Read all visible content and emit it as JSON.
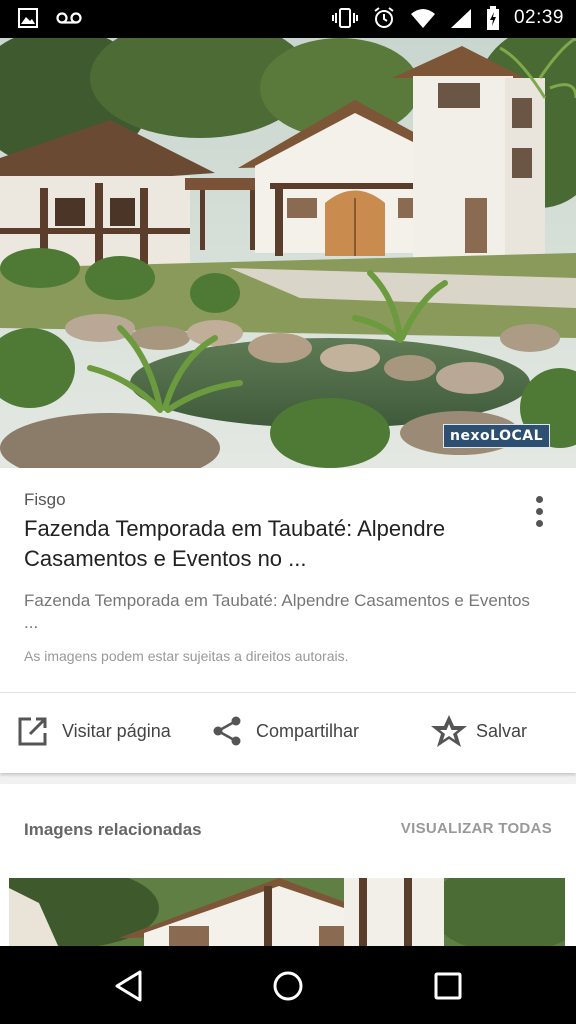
{
  "status_bar": {
    "time": "02:39",
    "icons": [
      "image-icon",
      "voicemail-icon",
      "vibrate-icon",
      "alarm-icon",
      "wifi-icon",
      "signal-icon",
      "battery-charging-icon"
    ]
  },
  "hero": {
    "watermark": "nexoLOCAL",
    "alt_subject": "farmhouse-photo"
  },
  "result": {
    "source": "Fisgo",
    "title": "Fazenda Temporada em Taubaté: Alpendre Casamentos e Eventos no ...",
    "description": "Fazenda Temporada em Taubaté: Alpendre Casamentos e Eventos ...",
    "copyright_notice": "As imagens podem estar sujeitas a direitos autorais."
  },
  "actions": {
    "visit_label": "Visitar página",
    "share_label": "Compartilhar",
    "save_label": "Salvar"
  },
  "related": {
    "heading": "Imagens relacionadas",
    "view_all_label": "VISUALIZAR TODAS"
  },
  "nav_bar": {
    "buttons": [
      "back-icon",
      "home-icon",
      "recents-icon"
    ]
  },
  "colors": {
    "status_bar_bg": "#000000",
    "card_bg": "#ffffff",
    "page_bg": "#f1f1f1",
    "title_text": "#222222",
    "secondary_text": "#777777"
  }
}
